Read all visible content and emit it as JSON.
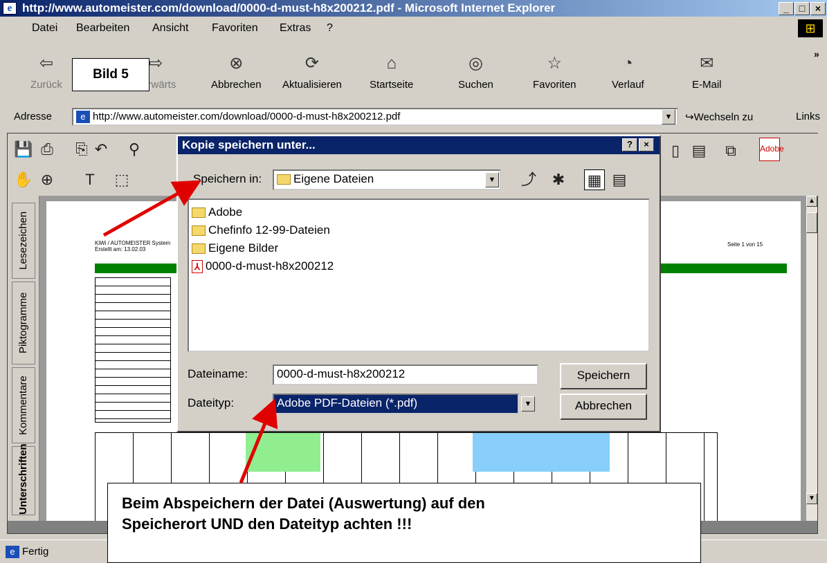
{
  "window": {
    "title": "http://www.automeister.com/download/0000-d-must-h8x200212.pdf - Microsoft Internet Explorer",
    "minimize": "_",
    "maximize": "□",
    "close": "×"
  },
  "menu": {
    "items": [
      "Datei",
      "Bearbeiten",
      "Ansicht",
      "Favoriten",
      "Extras",
      "?"
    ]
  },
  "toolbar": {
    "back": "Zurück",
    "forward": "Vorwärts",
    "stop": "Abbrechen",
    "refresh": "Aktualisieren",
    "home": "Startseite",
    "search": "Suchen",
    "favorites": "Favoriten",
    "history": "Verlauf",
    "mail": "E-Mail"
  },
  "address": {
    "label": "Adresse",
    "url": "http://www.automeister.com/download/0000-d-must-h8x200212.pdf",
    "go": "Wechseln zu",
    "links": "Links"
  },
  "annotation": {
    "bild": "Bild 5",
    "note_line1": "Beim Abspeichern der Datei (Auswertung) auf den",
    "note_line2": "Speicherort  UND den Dateityp achten !!!"
  },
  "sidebar": {
    "tabs": [
      "Lesezeichen",
      "Piktogramme",
      "Kommentare",
      "Unterschriften"
    ]
  },
  "document": {
    "header_left1": "KiWi / AUTOMEISTER System",
    "header_left2": "Erstellt am: 13.02.03",
    "page_info": "Seite 1 von 15"
  },
  "dialog": {
    "title": "Kopie speichern unter...",
    "help": "?",
    "close": "×",
    "save_in_label": "Speichern in:",
    "save_in_value": "Eigene Dateien",
    "files": [
      {
        "name": "Adobe",
        "type": "folder"
      },
      {
        "name": "Chefinfo 12-99-Dateien",
        "type": "folder"
      },
      {
        "name": "Eigene Bilder",
        "type": "folder"
      },
      {
        "name": "0000-d-must-h8x200212",
        "type": "pdf"
      }
    ],
    "filename_label": "Dateiname:",
    "filename_value": "0000-d-must-h8x200212",
    "filetype_label": "Dateityp:",
    "filetype_value": "Adobe PDF-Dateien (*.pdf)",
    "save_button": "Speichern",
    "cancel_button": "Abbrechen"
  },
  "status": {
    "text": "Fertig"
  },
  "colors": {
    "title_blue": "#0a246a",
    "arrow_red": "#e00000",
    "table_green": "#008000"
  }
}
